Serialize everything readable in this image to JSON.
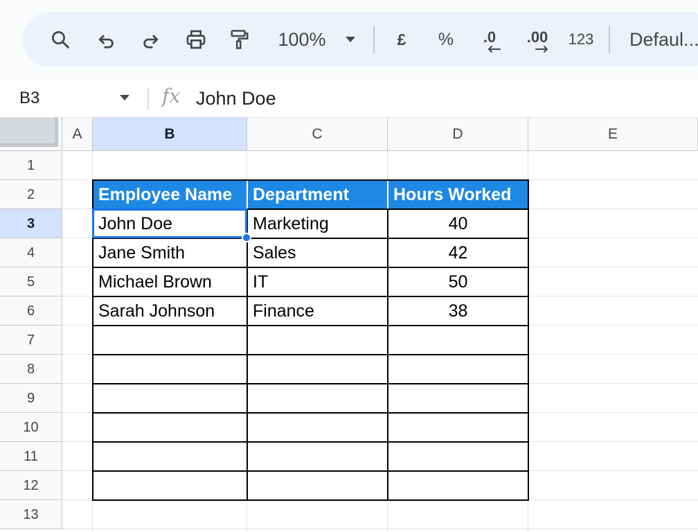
{
  "toolbar": {
    "zoom": "100%",
    "currency_symbol": "£",
    "percent_symbol": "%",
    "decrease_decimal": ".0",
    "increase_decimal": ".00",
    "more_formats": "123",
    "font_name": "Defaul..."
  },
  "formula_bar": {
    "name_box": "B3",
    "fx_label": "fx",
    "value": "John Doe"
  },
  "grid": {
    "columns": [
      "A",
      "B",
      "C",
      "D",
      "E"
    ],
    "rows": [
      "1",
      "2",
      "3",
      "4",
      "5",
      "6",
      "7",
      "8",
      "9",
      "10",
      "11",
      "12",
      "13"
    ],
    "active_cell": "B3",
    "table": {
      "headers": [
        "Employee Name",
        "Department",
        "Hours Worked"
      ],
      "rows": [
        [
          "John Doe",
          "Marketing",
          "40"
        ],
        [
          "Jane Smith",
          "Sales",
          "42"
        ],
        [
          "Michael Brown",
          "IT",
          "50"
        ],
        [
          "Sarah Johnson",
          "Finance",
          "38"
        ]
      ]
    }
  },
  "colors": {
    "table_header_fill": "#1e88e5",
    "selection": "#1a73e8",
    "active_header": "#d3e3fd"
  }
}
